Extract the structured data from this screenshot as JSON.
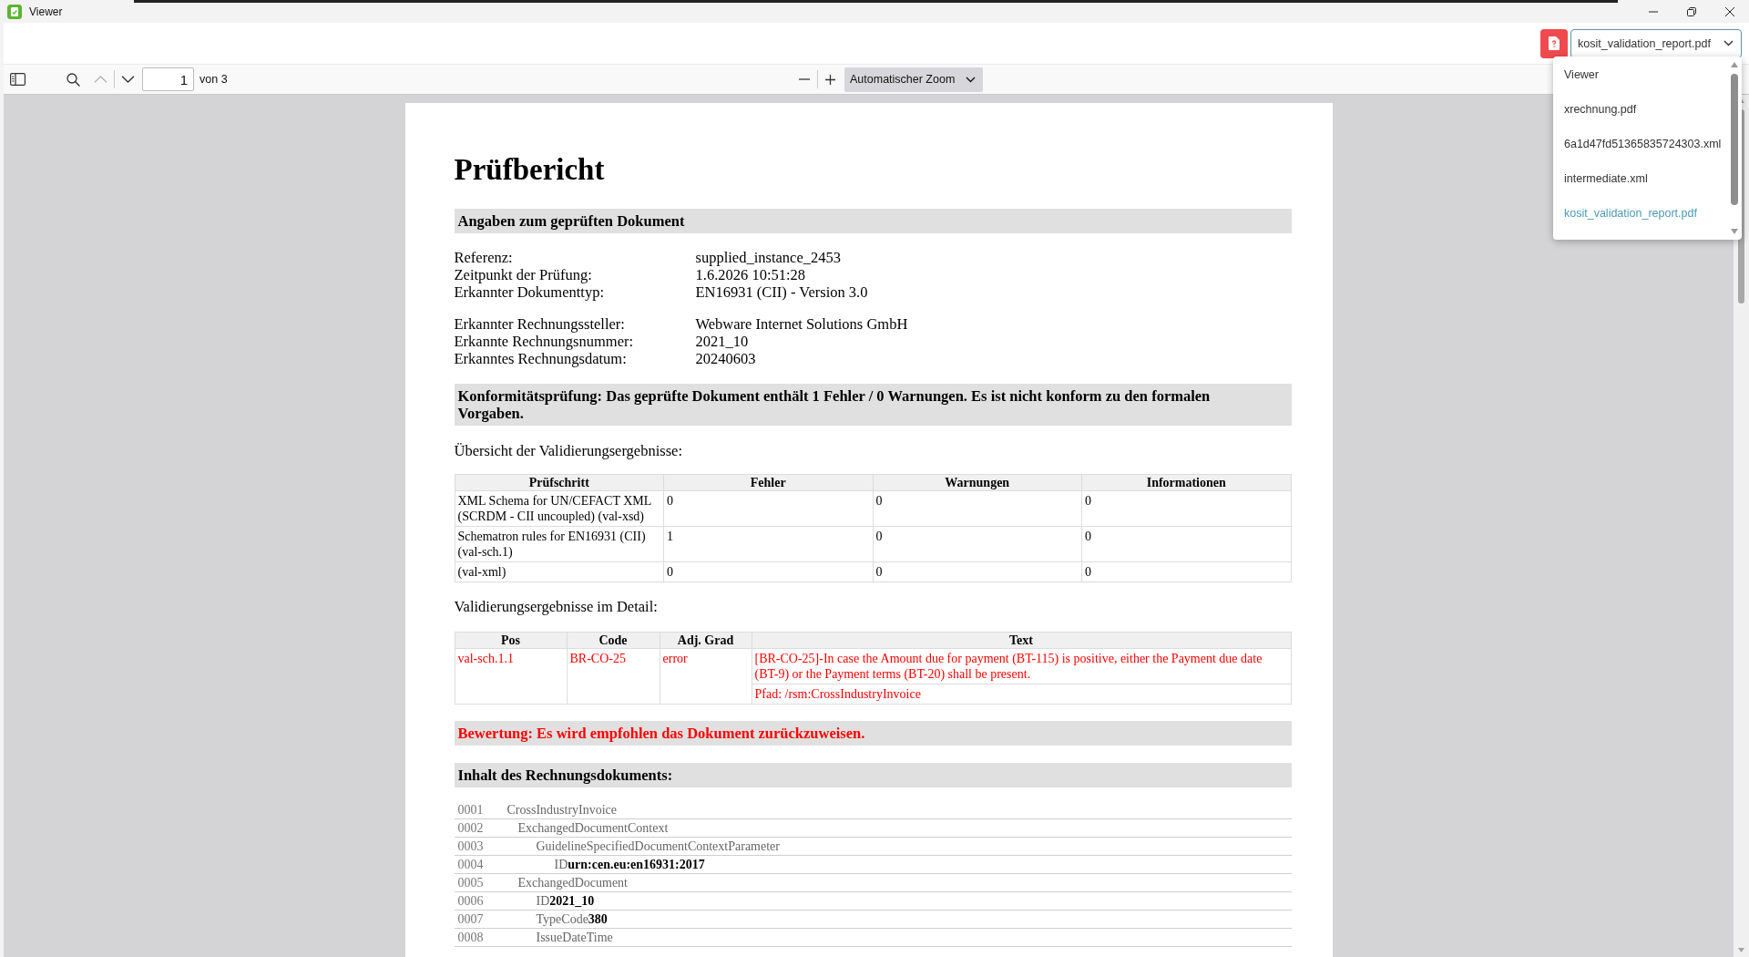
{
  "window": {
    "title": "Viewer"
  },
  "file_select": {
    "value": "kosit_validation_report.pdf",
    "expanded": true,
    "options": [
      {
        "label": "Viewer",
        "selected": false
      },
      {
        "label": "xrechnung.pdf",
        "selected": false
      },
      {
        "label": "6a1d47fd51365835724303.xml",
        "selected": false
      },
      {
        "label": "intermediate.xml",
        "selected": false
      },
      {
        "label": "kosit_validation_report.pdf",
        "selected": true
      }
    ]
  },
  "toolbar": {
    "previous_page": {
      "disabled": true
    },
    "next_page": {
      "disabled": false
    },
    "page_number": "1",
    "page_count": "von 3",
    "zoom": "Automatischer Zoom"
  },
  "report": {
    "title": "Prüfbericht",
    "document_heading": "Angaben zum geprüften Dokument",
    "detail_groups": [
      [
        {
          "label": "Referenz:",
          "value": "supplied_instance_2453"
        },
        {
          "label": "Zeitpunkt der Prüfung:",
          "value": "1.6.2026 10:51:28"
        },
        {
          "label": "Erkannter Dokumenttyp:",
          "value": "EN16931 (CII) - Version 3.0"
        }
      ],
      [
        {
          "label": "Erkannter Rechnungssteller:",
          "value": "Webware Internet Solutions GmbH"
        },
        {
          "label": "Erkannte Rechnungsnummer:",
          "value": "2021_10"
        },
        {
          "label": "Erkanntes Rechnungsdatum:",
          "value": "20240603"
        }
      ]
    ],
    "conformity_heading": "Konformitätsprüfung: Das geprüfte Dokument enthält 1 Fehler / 0 Warnungen. Es ist nicht konform zu den formalen Vorgaben.",
    "overview_caption": "Übersicht der Validierungsergebnisse:",
    "overview_table": {
      "columns": [
        "Prüfschritt",
        "Fehler",
        "Warnungen",
        "Informationen"
      ],
      "rows": [
        [
          "XML Schema for UN/CEFACT XML (SCRDM - CII uncoupled) (val-xsd)",
          "0",
          "0",
          "0"
        ],
        [
          "Schematron rules for EN16931 (CII) (val-sch.1)",
          "1",
          "0",
          "0"
        ],
        [
          "(val-xml)",
          "0",
          "0",
          "0"
        ]
      ]
    },
    "detail_caption": "Validierungsergebnisse im Detail:",
    "detail_table": {
      "columns": [
        "Pos",
        "Code",
        "Adj. Grad",
        "Text"
      ],
      "rows": [
        {
          "pos": "val-sch.1.1",
          "code": "BR-CO-25",
          "grade": "error",
          "message": "[BR-CO-25]-In case the Amount due for payment (BT-115) is positive, either the Payment due date (BT-9) or the Payment terms (BT-20) shall be present.",
          "path": "Pfad: /rsm:CrossIndustryInvoice"
        }
      ]
    },
    "assessment": "Bewertung: Es wird empfohlen das Dokument zurückzuweisen.",
    "content_heading": "Inhalt des Rechnungsdokuments:",
    "listing": [
      {
        "line": "0001",
        "element": "CrossIndustryInvoice",
        "children": [
          {
            "line": "0002",
            "element": "ExchangedDocumentContext",
            "children": [
              {
                "line": "0003",
                "element": "GuidelineSpecifiedDocumentContextParameter",
                "children": [
                  {
                    "line": "0004",
                    "element": "ID",
                    "value": "urn:cen.eu:en16931:2017"
                  }
                ]
              }
            ]
          },
          {
            "line": "0005",
            "element": "ExchangedDocument",
            "children": [
              {
                "line": "0006",
                "element": "ID",
                "value": "2021_10"
              },
              {
                "line": "0007",
                "element": "TypeCode",
                "value": "380"
              },
              {
                "line": "0008",
                "element": "IssueDateTime"
              }
            ]
          }
        ]
      }
    ]
  }
}
